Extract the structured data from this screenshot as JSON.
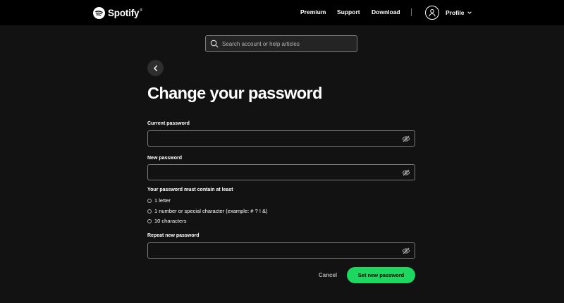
{
  "header": {
    "logo_text": "Spotify",
    "logo_tm": "®",
    "nav": {
      "premium": "Premium",
      "support": "Support",
      "download": "Download"
    },
    "profile_label": "Profile"
  },
  "search": {
    "placeholder": "Search account or help articles",
    "value": ""
  },
  "page": {
    "title": "Change your password"
  },
  "form": {
    "current_password": {
      "label": "Current password",
      "value": ""
    },
    "new_password": {
      "label": "New password",
      "value": ""
    },
    "requirements_title": "Your password must contain at least",
    "requirements": [
      "1 letter",
      "1 number or special character (example: # ? ! &)",
      "10 characters"
    ],
    "repeat_password": {
      "label": "Repeat new password",
      "value": ""
    },
    "cancel_label": "Cancel",
    "submit_label": "Set new password"
  },
  "colors": {
    "background": "#121212",
    "header": "#000000",
    "accent": "#1ed760",
    "border": "#7a7a7a"
  },
  "icons": [
    "spotify-logo-icon",
    "user-icon",
    "chevron-down-icon",
    "search-icon",
    "chevron-left-icon",
    "eye-off-icon"
  ]
}
